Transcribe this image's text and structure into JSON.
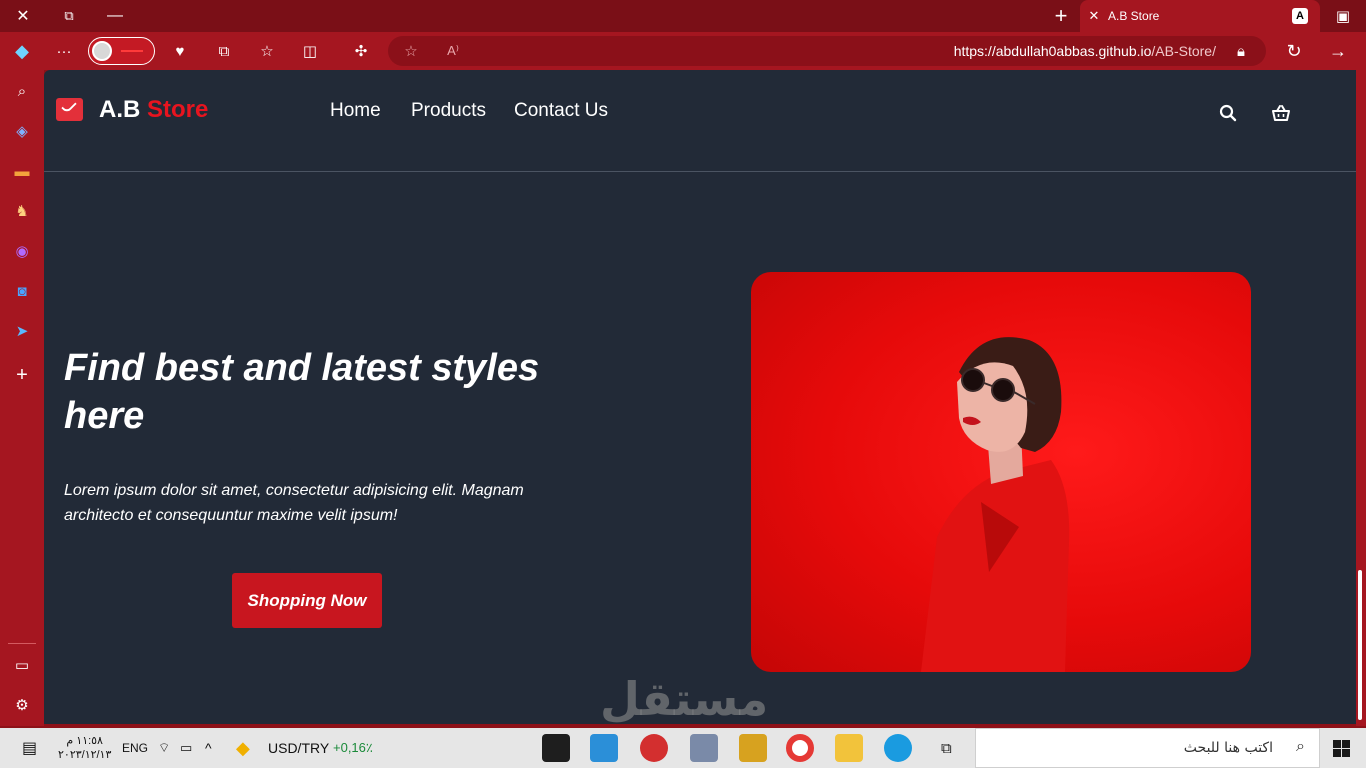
{
  "browser": {
    "tab_title": "A.B Store",
    "tab_favicon": "A",
    "url_host": "https://abdullah0abbas.github.io",
    "url_path": "/AB-Store/",
    "accent": "#a51620"
  },
  "site": {
    "brand_prefix": "A.B",
    "brand_suffix": "Store",
    "nav": [
      "Home",
      "Products",
      "Contact Us"
    ],
    "hero_title": "Find best and latest styles here",
    "hero_text": "Lorem ipsum dolor sit amet, consectetur adipisicing elit. Magnam architecto et consequuntur maxime velit ipsum!",
    "cta_label": "Shopping Now",
    "background": "#222a37",
    "brand_red": "#e8141f"
  },
  "watermark": "مستقل",
  "taskbar": {
    "time": "١١:٥٨ م",
    "date": "٢٠٢٣/١٢/١٣",
    "language": "ENG",
    "ticker": "USD/TRY",
    "ticker_change": "+0,16٪",
    "search_placeholder": "اكتب هنا للبحث"
  }
}
